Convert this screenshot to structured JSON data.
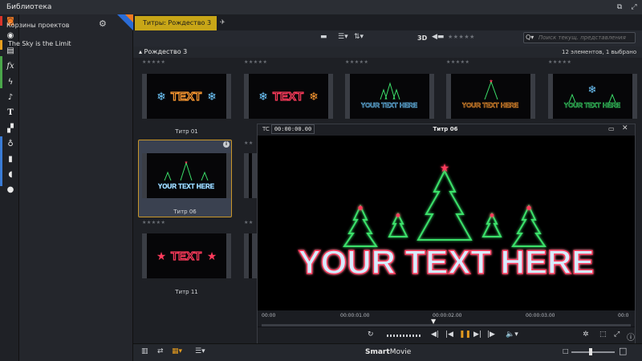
{
  "window": {
    "title": "Библиотека",
    "restore_glyph": "⧉",
    "popout_glyph": "⤢",
    "close_glyph": "✕"
  },
  "rail": {
    "icons": [
      "folder-icon",
      "disc-icon",
      "layers-icon",
      "fx-icon",
      "bolt-icon",
      "music-icon",
      "text-icon",
      "transition-icon",
      "timer-icon",
      "fader-icon",
      "sound-icon",
      "sticker-icon"
    ],
    "strip_colors": [
      "#d9342b",
      "#e8a020",
      "#4aa64a",
      "#3a7bd5"
    ]
  },
  "bins": {
    "title": "Корзины проектов",
    "gear_glyph": "⚙",
    "items": [
      "The Sky is the Limit"
    ]
  },
  "tabs": {
    "active_label": "Титры: Рождество 3",
    "add_glyph": "✈"
  },
  "toolbar": {
    "label_3d": "3D",
    "stars": "★★★★★",
    "search_placeholder": "Поиск текущ. представления",
    "search_glyph": "Q▾"
  },
  "library": {
    "breadcrumb": "▴ Рождество 3",
    "count": "12 элементов, 1 выбрано",
    "cards": [
      {
        "label": "Титр 01",
        "stars": "★★★★★",
        "text": "TEXT"
      },
      {
        "label": "",
        "stars": "★★★★★",
        "text": "TEXT"
      },
      {
        "label": "",
        "stars": "★★★★★",
        "text": "YOUR TEXT HERE"
      },
      {
        "label": "",
        "stars": "★★★★★",
        "text": "YOUR TEXT HERE"
      },
      {
        "label": "",
        "stars": "★★★★★",
        "text": "YOUR TEXT HERE"
      },
      {
        "label": "Титр 06",
        "stars": "",
        "text": "YOUR TEXT HERE"
      },
      {
        "label": "Титр 11",
        "stars": "★★★★★",
        "text": "TEXT"
      }
    ],
    "selected_info_glyph": "i"
  },
  "preview": {
    "tc_label": "TC",
    "timecode": "00:00:00.00",
    "title": "Титр 06",
    "restore_glyph": "▭",
    "close_glyph": "✕",
    "video_text": "YOUR TEXT HERE",
    "ruler": [
      "00:00",
      "00:00:01.00",
      "00:00:02.00",
      "00:00:03.00",
      "00:0"
    ],
    "controls": {
      "loop": "↻",
      "prev": "◀|",
      "back": "|◀",
      "pause": "❚❚",
      "fwd": "▶|",
      "next": "|▶",
      "volume": "🔈▾",
      "settings": "✲",
      "export": "⬚",
      "fullscreen": "⤢",
      "info": "ⓘ"
    }
  },
  "bottom": {
    "brand_bold": "Smart",
    "brand_rest": "Movie",
    "icons": [
      "trash-icon",
      "swap-icon",
      "grid-view-icon",
      "list-view-icon"
    ],
    "zoom_small": "□",
    "zoom_large": "□",
    "zoom_level": 0.45
  },
  "colors": {
    "accent": "#c8a617",
    "selection": "#c8962a",
    "neon_green": "#3be06a",
    "neon_red": "#ff3b5c",
    "neon_blue": "#6fc9ff",
    "neon_orange": "#ff9b32"
  }
}
